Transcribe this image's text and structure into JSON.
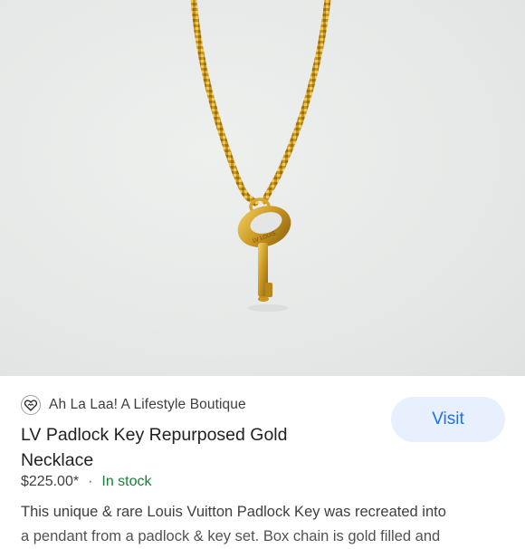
{
  "hero": {
    "image_subject": "Gold key pendant on gold box chain",
    "engraving": "LOUIS VUITTON"
  },
  "merchant": {
    "name": "Ah La Laa! A Lifestyle Boutique",
    "logo_icon": "heart-logo-icon"
  },
  "product": {
    "title": "LV Padlock Key Repurposed Gold Necklace",
    "price": "$225.00*",
    "separator": "·",
    "stock": "In stock",
    "description_line1": "This unique & rare Louis Vuitton Padlock Key was recreated into",
    "description_line2": "a pendant from a padlock & key set. Box chain is gold filled and"
  },
  "actions": {
    "visit_label": "Visit"
  },
  "colors": {
    "accent": "#1a73e8",
    "visit_bg": "#e8f0fe",
    "stock_green": "#188038",
    "gold": "#c9961f"
  }
}
